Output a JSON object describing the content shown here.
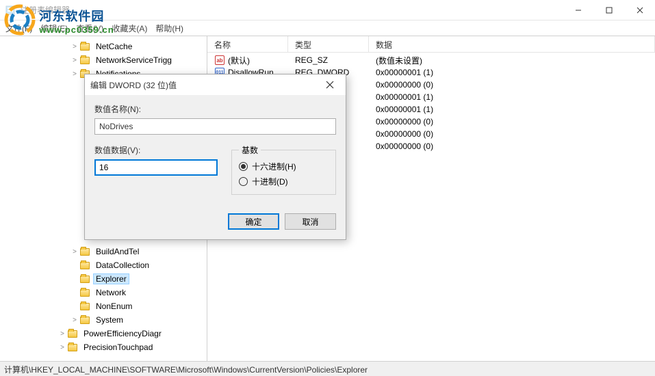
{
  "window": {
    "title": "注册表编辑器"
  },
  "watermark": {
    "brand": "河东软件园",
    "url": "www.pc0359.cn"
  },
  "menu": {
    "file": "文件(F)",
    "edit": "编辑(E)",
    "view": "查看(V)",
    "favorites": "收藏夹(A)",
    "help": "帮助(H)"
  },
  "tree": {
    "items": [
      {
        "indent": 4,
        "expand": ">",
        "label": "NetCache"
      },
      {
        "indent": 4,
        "expand": ">",
        "label": "NetworkServiceTrigg"
      },
      {
        "indent": 4,
        "expand": ">",
        "label": "Notifications"
      },
      {
        "indent": 4,
        "expand": ">",
        "label": "BuildAndTel"
      },
      {
        "indent": 4,
        "expand": "",
        "label": "DataCollection"
      },
      {
        "indent": 4,
        "expand": "",
        "label": "Explorer",
        "selected": true
      },
      {
        "indent": 4,
        "expand": "",
        "label": "Network"
      },
      {
        "indent": 4,
        "expand": "",
        "label": "NonEnum"
      },
      {
        "indent": 4,
        "expand": ">",
        "label": "System"
      },
      {
        "indent": 3,
        "expand": ">",
        "label": "PowerEfficiencyDiagr"
      },
      {
        "indent": 3,
        "expand": ">",
        "label": "PrecisionTouchpad"
      }
    ]
  },
  "list": {
    "headers": {
      "name": "名称",
      "type": "类型",
      "data": "数据"
    },
    "rows": [
      {
        "icon": "str",
        "name": "(默认)",
        "type": "REG_SZ",
        "data": "(数值未设置)"
      },
      {
        "icon": "bin",
        "name": "DisallowRun",
        "type": "REG_DWORD",
        "data": "0x00000001 (1)"
      },
      {
        "icon": "bin",
        "name": "",
        "type": "",
        "data": "0x00000000 (0)"
      },
      {
        "icon": "bin",
        "name": "",
        "type": "",
        "data": "0x00000001 (1)"
      },
      {
        "icon": "bin",
        "name": "",
        "type": "",
        "data": "0x00000001 (1)"
      },
      {
        "icon": "bin",
        "name": "",
        "type": "",
        "data": "0x00000000 (0)"
      },
      {
        "icon": "bin",
        "name": "",
        "type": "",
        "data": "0x00000000 (0)"
      },
      {
        "icon": "bin",
        "name": "",
        "type": "",
        "data": "0x00000000 (0)"
      }
    ]
  },
  "dialog": {
    "title": "编辑 DWORD (32 位)值",
    "name_label": "数值名称(N):",
    "name_value": "NoDrives",
    "data_label": "数值数据(V):",
    "data_value": "16",
    "base_label": "基数",
    "radio_hex": "十六进制(H)",
    "radio_dec": "十进制(D)",
    "ok": "确定",
    "cancel": "取消"
  },
  "statusbar": {
    "path": "计算机\\HKEY_LOCAL_MACHINE\\SOFTWARE\\Microsoft\\Windows\\CurrentVersion\\Policies\\Explorer"
  }
}
